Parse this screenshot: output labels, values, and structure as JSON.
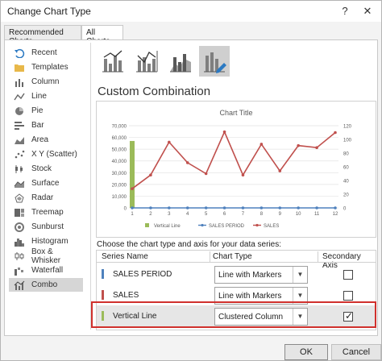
{
  "window": {
    "title": "Change Chart Type",
    "help_label": "?",
    "close_label": "✕"
  },
  "tabs": [
    {
      "label": "Recommended Charts"
    },
    {
      "label": "All Charts"
    }
  ],
  "sidebar": {
    "items": [
      {
        "label": "Recent",
        "icon": "recent-icon"
      },
      {
        "label": "Templates",
        "icon": "templates-icon"
      },
      {
        "label": "Column",
        "icon": "column-chart-icon"
      },
      {
        "label": "Line",
        "icon": "line-chart-icon"
      },
      {
        "label": "Pie",
        "icon": "pie-chart-icon"
      },
      {
        "label": "Bar",
        "icon": "bar-chart-icon"
      },
      {
        "label": "Area",
        "icon": "area-chart-icon"
      },
      {
        "label": "X Y (Scatter)",
        "icon": "scatter-chart-icon"
      },
      {
        "label": "Stock",
        "icon": "stock-chart-icon"
      },
      {
        "label": "Surface",
        "icon": "surface-chart-icon"
      },
      {
        "label": "Radar",
        "icon": "radar-chart-icon"
      },
      {
        "label": "Treemap",
        "icon": "treemap-chart-icon"
      },
      {
        "label": "Sunburst",
        "icon": "sunburst-chart-icon"
      },
      {
        "label": "Histogram",
        "icon": "histogram-chart-icon"
      },
      {
        "label": "Box & Whisker",
        "icon": "box-whisker-chart-icon"
      },
      {
        "label": "Waterfall",
        "icon": "waterfall-chart-icon"
      },
      {
        "label": "Combo",
        "icon": "combo-chart-icon"
      }
    ],
    "selected": "Combo"
  },
  "section_title": "Custom Combination",
  "preview_chart": {
    "title": "Chart Title",
    "left_ticks": [
      "70,000",
      "60,000",
      "50,000",
      "40,000",
      "30,000",
      "20,000",
      "10,000",
      "0"
    ],
    "right_ticks": [
      "120",
      "100",
      "80",
      "60",
      "40",
      "20",
      "0"
    ],
    "categories": [
      "1",
      "2",
      "3",
      "4",
      "5",
      "6",
      "7",
      "8",
      "9",
      "10",
      "11",
      "12"
    ],
    "legend": [
      "Vertical Line",
      "SALES PERIOD",
      "SALES"
    ]
  },
  "chart_data": {
    "type": "line",
    "title": "Chart Title",
    "x": [
      1,
      2,
      3,
      4,
      5,
      6,
      7,
      8,
      9,
      10,
      11,
      12
    ],
    "ylim_left": [
      0,
      70000
    ],
    "ylim_right": [
      0,
      120
    ],
    "series": [
      {
        "name": "Vertical Line",
        "type": "column",
        "axis": "primary",
        "values": [
          57000,
          0,
          0,
          0,
          0,
          0,
          0,
          0,
          0,
          0,
          0,
          0
        ],
        "color": "#9bbb59"
      },
      {
        "name": "SALES PERIOD",
        "type": "line",
        "axis": "primary",
        "values": [
          0,
          0,
          0,
          0,
          0,
          0,
          0,
          0,
          0,
          0,
          0,
          0
        ],
        "color": "#4f81bd"
      },
      {
        "name": "SALES",
        "type": "line",
        "axis": "secondary",
        "values": [
          28,
          48,
          96,
          66,
          50,
          111,
          48,
          93,
          54,
          91,
          88,
          110
        ],
        "color": "#c0504d"
      }
    ],
    "grid": true,
    "legend_position": "bottom"
  },
  "series_table": {
    "prompt": "Choose the chart type and axis for your data series:",
    "headers": {
      "name": "Series Name",
      "type": "Chart Type",
      "axis": "Secondary Axis"
    },
    "rows": [
      {
        "name": "SALES PERIOD",
        "chart_type": "Line with Markers",
        "secondary": false,
        "color": "#4f81bd"
      },
      {
        "name": "SALES",
        "chart_type": "Line with Markers",
        "secondary": false,
        "color": "#c0504d"
      },
      {
        "name": "Vertical Line",
        "chart_type": "Clustered Column",
        "secondary": true,
        "color": "#9bbb59"
      }
    ]
  },
  "buttons": {
    "ok": "OK",
    "cancel": "Cancel"
  }
}
